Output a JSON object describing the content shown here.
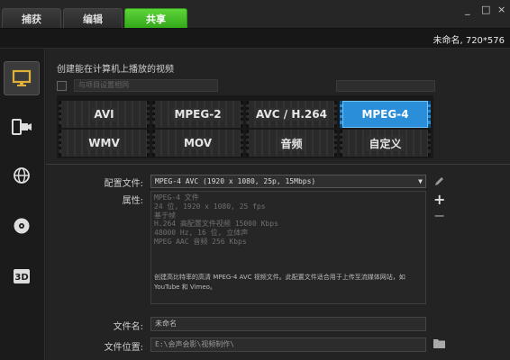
{
  "tabs": [
    {
      "label": "捕获",
      "active": false
    },
    {
      "label": "编辑",
      "active": false
    },
    {
      "label": "共享",
      "active": true
    }
  ],
  "window_controls": {
    "minimize": "_",
    "restore": "□",
    "close": "×"
  },
  "project": {
    "name": "未命名, 720*576"
  },
  "sidebar": {
    "items": [
      {
        "icon": "computer-icon",
        "active": true
      },
      {
        "icon": "device-icon",
        "active": false
      },
      {
        "icon": "globe-icon",
        "active": false
      },
      {
        "icon": "disc-icon",
        "active": false
      },
      {
        "icon": "3d-icon",
        "active": false
      }
    ]
  },
  "main": {
    "heading": "创建能在计算机上播放的视频",
    "match_project": {
      "checked": false,
      "dropdown_value": "与项目设置相同"
    },
    "formats": [
      {
        "label": "AVI",
        "active": false
      },
      {
        "label": "MPEG-2",
        "active": false
      },
      {
        "label": "AVC / H.264",
        "active": false
      },
      {
        "label": "MPEG-4",
        "active": true
      },
      {
        "label": "WMV",
        "active": false
      },
      {
        "label": "MOV",
        "active": false
      },
      {
        "label": "音频",
        "active": false
      },
      {
        "label": "自定义",
        "active": false
      }
    ],
    "config_file": {
      "label": "配置文件:",
      "value": "MPEG-4 AVC (1920 x 1080, 25p, 15Mbps)"
    },
    "properties": {
      "label": "属性:",
      "lines": [
        "MPEG-4 文件",
        "24 位, 1920 x 1080, 25 fps",
        "基于帧",
        "H.264 高配置文件视频 15000 Kbps",
        "48000 Hz, 16 位, 立体声",
        "MPEG AAC 音频 256 Kbps"
      ],
      "description": "创建高比特率的高清 MPEG-4 AVC 视频文件。此配置文件适合用于上传至流媒体网站，如 YouTube 和 Vimeo。"
    },
    "file_name": {
      "label": "文件名:",
      "value": "未命名"
    },
    "file_location": {
      "label": "文件位置:",
      "value": "E:\\会声会影\\视频制作\\"
    }
  },
  "colors": {
    "active_tab": "#3fb826",
    "active_format": "#2a8fd8",
    "background": "#232323"
  }
}
